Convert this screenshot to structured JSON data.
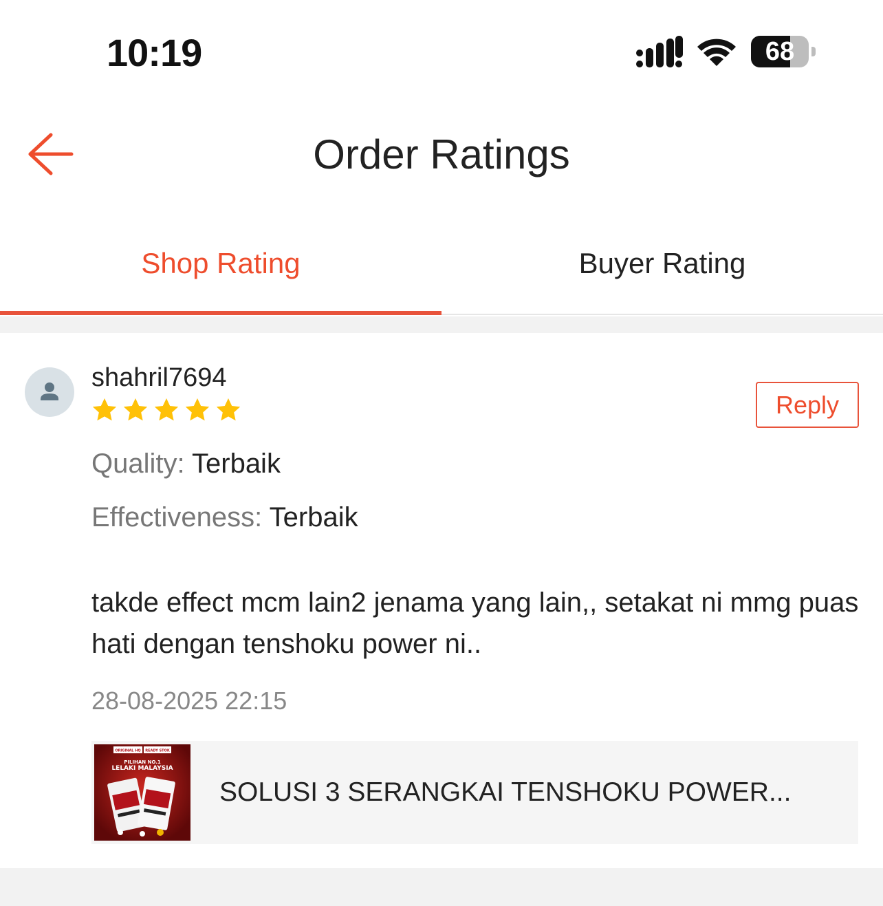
{
  "status_bar": {
    "time": "10:19",
    "battery_percent": "68",
    "battery_level": 0.68,
    "icons": [
      "cellular-signal-icon",
      "wifi-icon",
      "battery-icon"
    ]
  },
  "header": {
    "title": "Order Ratings",
    "back_icon": "arrow-left-icon",
    "accent_color": "#ee4d2d"
  },
  "tabs": [
    {
      "label": "Shop Rating",
      "active": true
    },
    {
      "label": "Buyer Rating",
      "active": false
    }
  ],
  "review": {
    "username": "shahril7694",
    "avatar_icon": "user-icon",
    "rating": 5,
    "rating_max": 5,
    "star_color": "#ffc107",
    "reply_label": "Reply",
    "attributes": [
      {
        "label": "Quality:",
        "value": "Terbaik"
      },
      {
        "label": "Effectiveness:",
        "value": "Terbaik"
      }
    ],
    "comment": "takde effect mcm lain2 jenama yang lain,, setakat ni mmg puas hati dengan tenshoku power ni..",
    "datetime": "28-08-2025 22:15",
    "product": {
      "name": "SOLUSI  3 SERANGKAI TENSHOKU POWER...",
      "thumb_labels": {
        "badge_left": "ORIGINAL HQ",
        "badge_right": "READY STOK",
        "headline": "PILIHAN NO.1",
        "subheadline": "LELAKI MALAYSIA"
      }
    }
  }
}
